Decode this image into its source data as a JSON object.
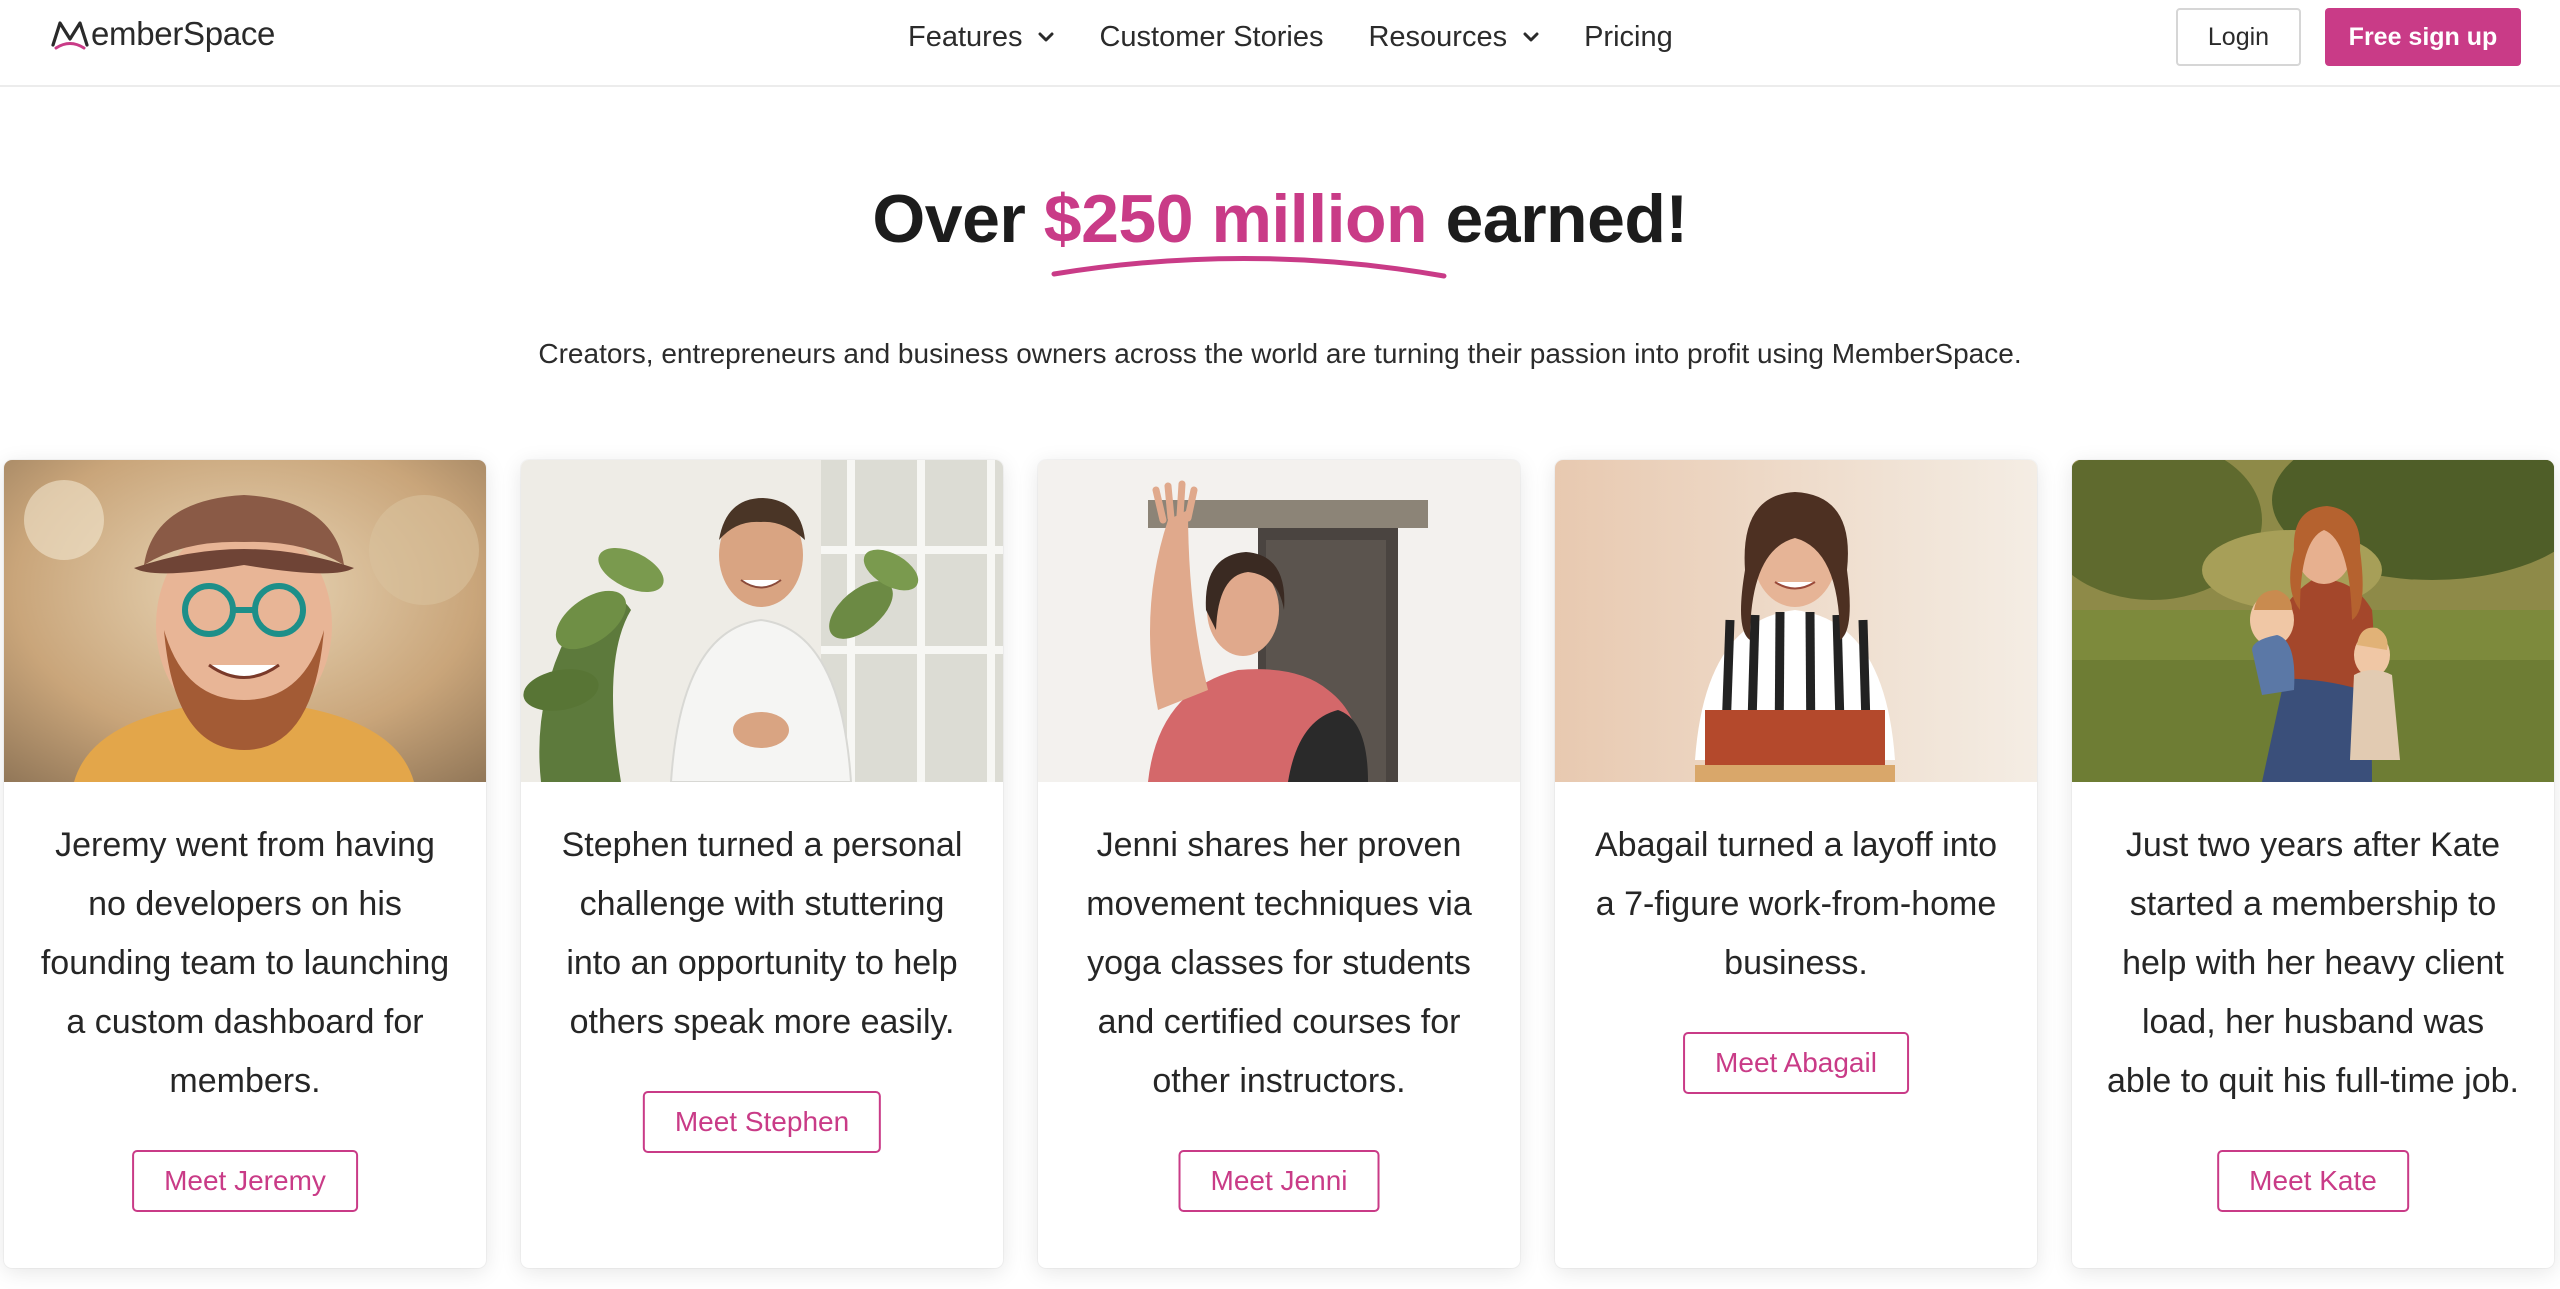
{
  "nav": {
    "logo_text": "emberSpace",
    "menu": [
      {
        "label": "Features",
        "has_dropdown": true
      },
      {
        "label": "Customer Stories",
        "has_dropdown": false
      },
      {
        "label": "Resources",
        "has_dropdown": true
      },
      {
        "label": "Pricing",
        "has_dropdown": false
      }
    ],
    "login_label": "Login",
    "signup_label": "Free sign up"
  },
  "hero": {
    "headline_before": "Over ",
    "headline_accent": "$250 million",
    "headline_after": " earned!",
    "subheading": "Creators, entrepreneurs and business owners across the world are turning their passion into profit using MemberSpace."
  },
  "cards": [
    {
      "photo": "jeremy-portrait",
      "text": "Jeremy went from having no developers on his founding team to launching a custom dashboard for members.",
      "button": "Meet Jeremy"
    },
    {
      "photo": "stephen-portrait",
      "text": "Stephen turned a personal challenge with stuttering into an opportunity to help others speak more easily.",
      "button": "Meet Stephen"
    },
    {
      "photo": "jenni-portrait",
      "text": "Jenni shares her proven movement techniques via yoga classes for students and certified courses for other instructors.",
      "button": "Meet Jenni"
    },
    {
      "photo": "abagail-portrait",
      "text": "Abagail turned a layoff into a 7-figure work-from-home business.",
      "button": "Meet Abagail"
    },
    {
      "photo": "kate-portrait",
      "text": "Just two years after Kate started a membership to help with her heavy client load, her husband was able to quit his full-time job.",
      "button": "Meet Kate"
    }
  ],
  "colors": {
    "brand": "#c93b87",
    "text": "#1c1c1c"
  }
}
